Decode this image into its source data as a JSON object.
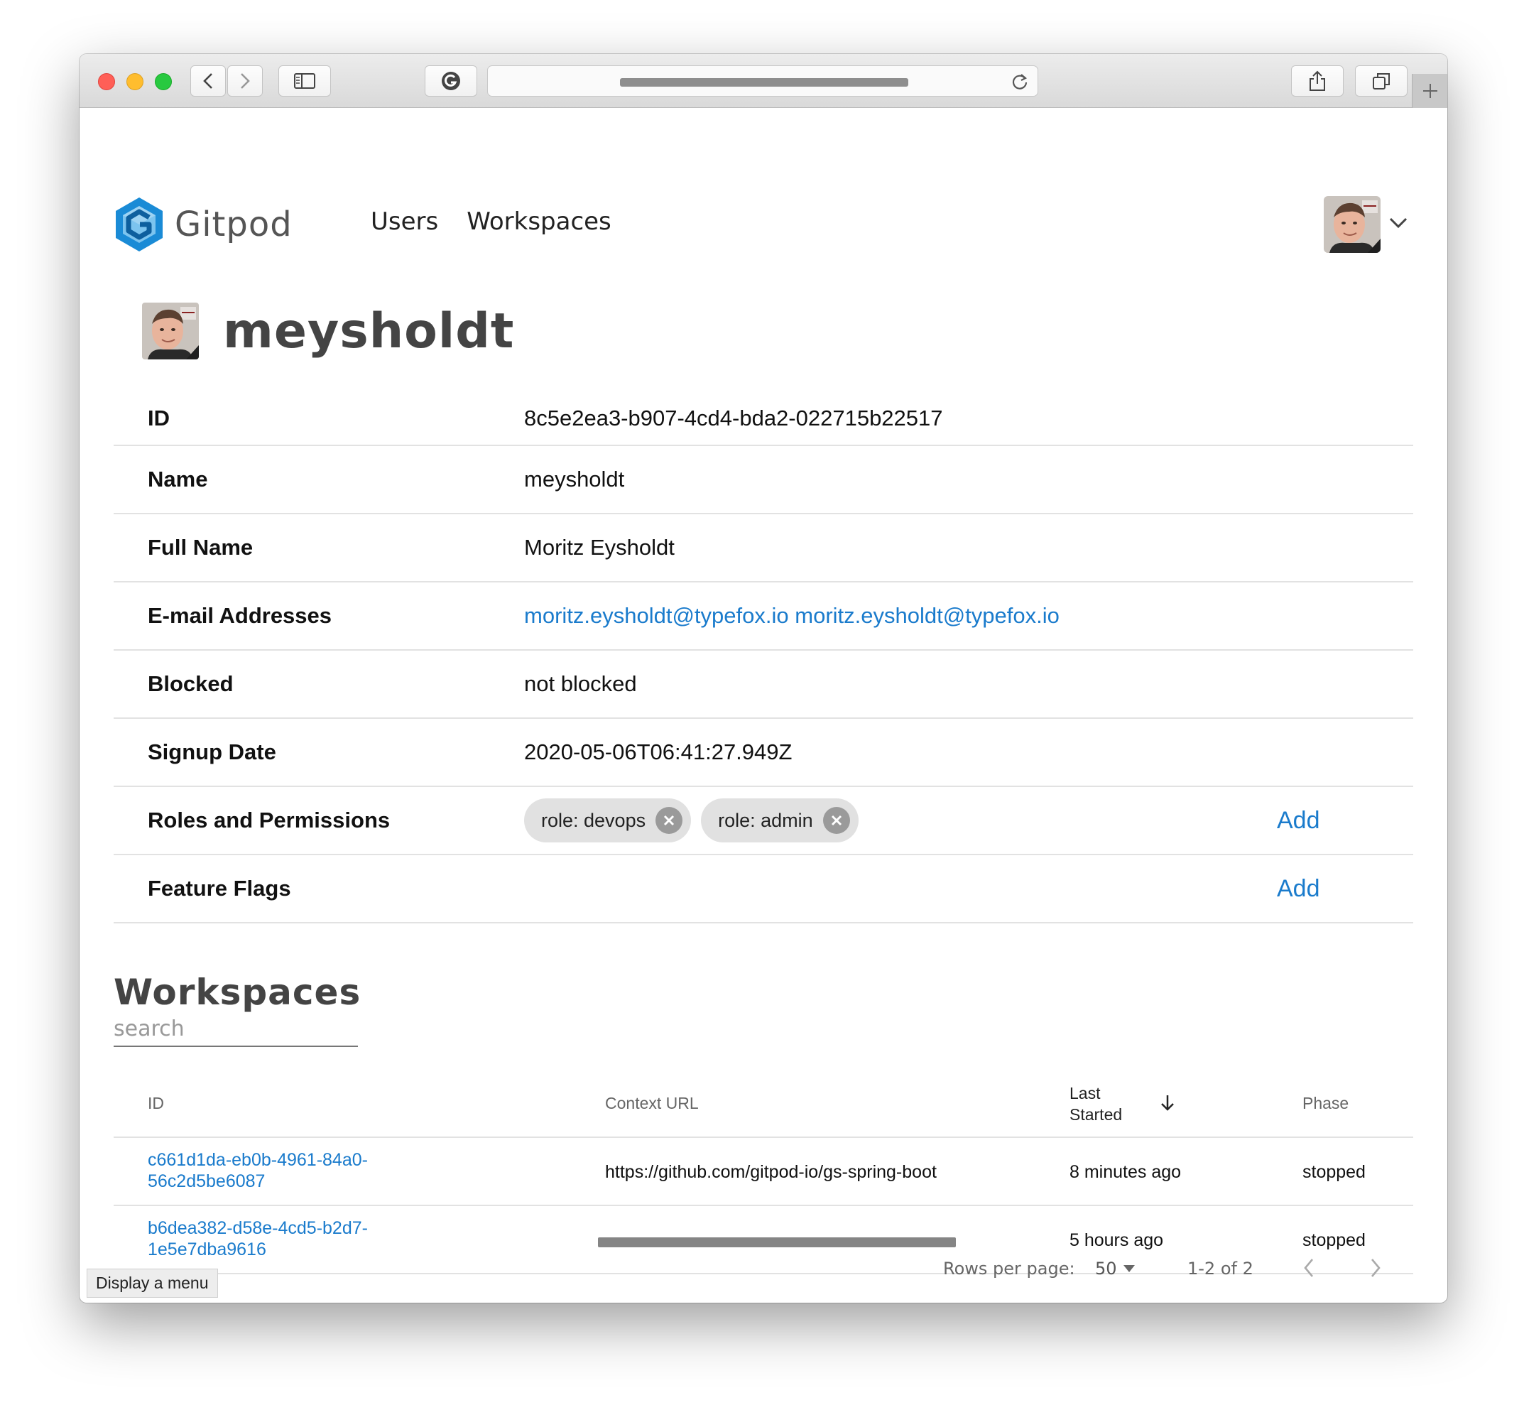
{
  "browser": {
    "url": "",
    "new_tab_symbol": "+"
  },
  "header": {
    "logo_text": "Gitpod",
    "nav": [
      "Users",
      "Workspaces"
    ]
  },
  "user": {
    "username": "meysholdt",
    "properties": [
      {
        "label": "ID",
        "value": "8c5e2ea3-b907-4cd4-bda2-022715b22517"
      },
      {
        "label": "Name",
        "value": "meysholdt"
      },
      {
        "label": "Full Name",
        "value": "Moritz Eysholdt"
      },
      {
        "label": "E-mail Addresses",
        "emails": [
          "moritz.eysholdt@typefox.io",
          "moritz.eysholdt@typefox.io"
        ]
      },
      {
        "label": "Blocked",
        "value": "not blocked"
      },
      {
        "label": "Signup Date",
        "value": "2020-05-06T06:41:27.949Z"
      },
      {
        "label": "Roles and Permissions",
        "chips": [
          "role: devops",
          "role: admin"
        ],
        "action": "Add"
      },
      {
        "label": "Feature Flags",
        "action": "Add"
      }
    ]
  },
  "workspaces": {
    "title": "Workspaces",
    "search_placeholder": "search",
    "columns": {
      "id": "ID",
      "context_url": "Context URL",
      "last_started_line1": "Last",
      "last_started_line2": "Started",
      "phase": "Phase"
    },
    "rows": [
      {
        "id_line1": "c661d1da-eb0b-4961-84a0-",
        "id_line2": "56c2d5be6087",
        "context_url": "https://github.com/gitpod-io/gs-spring-boot",
        "last_started": "8 minutes ago",
        "phase": "stopped"
      },
      {
        "id_line1": "b6dea382-d58e-4cd5-b2d7-",
        "id_line2": "1e5e7dba9616",
        "context_url": "",
        "last_started": "5 hours ago",
        "phase": "stopped"
      }
    ],
    "pagination": {
      "rows_per_page_label": "Rows per page:",
      "rows_per_page": "50",
      "range": "1-2 of 2"
    }
  },
  "tooltip": "Display a menu",
  "colors": {
    "link": "#1a7bcc",
    "logo_blue": "#1a8bd6"
  }
}
